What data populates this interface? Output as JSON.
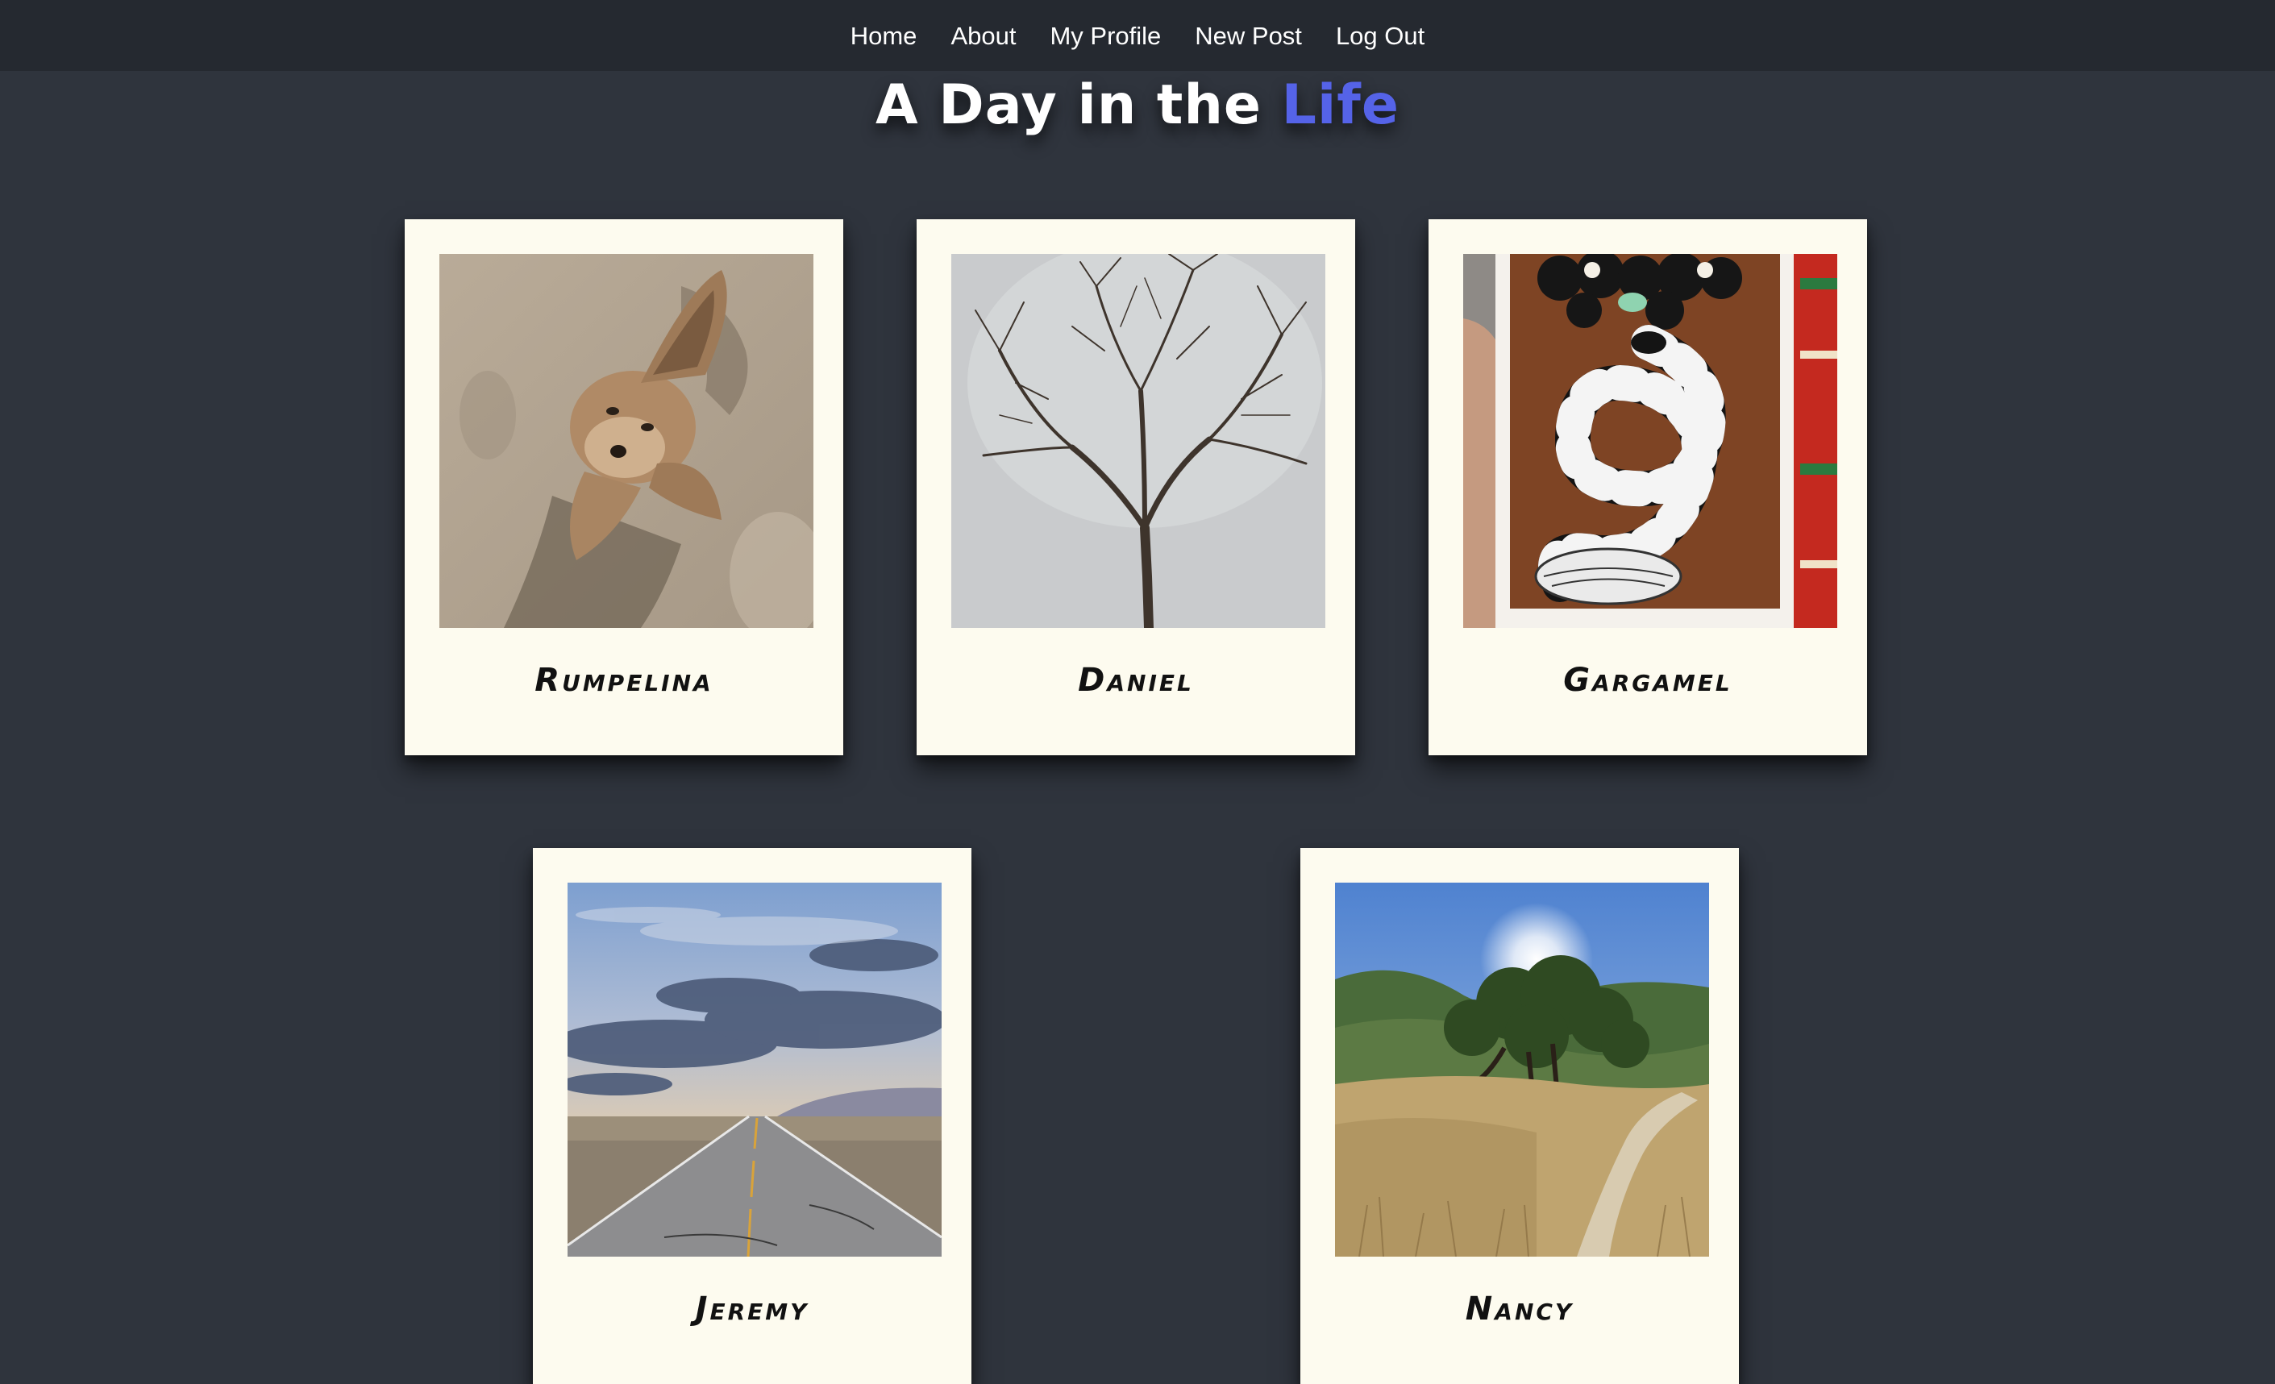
{
  "nav": {
    "home": "Home",
    "about": "About",
    "my_profile": "My Profile",
    "new_post": "New Post",
    "log_out": "Log Out"
  },
  "header": {
    "title_main": "A Day in the",
    "title_accent": "Life",
    "accent_color": "#5563e8"
  },
  "posts": [
    {
      "name": "Rumpelina",
      "photo": "dog lying in sand"
    },
    {
      "name": "Daniel",
      "photo": "bare tree against grey sky"
    },
    {
      "name": "Gargamel",
      "photo": "snake illustration card held in hand"
    },
    {
      "name": "Jeremy",
      "photo": "desert highway under cloudy sky"
    },
    {
      "name": "Nancy",
      "photo": "oak tree on grassy hillside with sun"
    }
  ]
}
